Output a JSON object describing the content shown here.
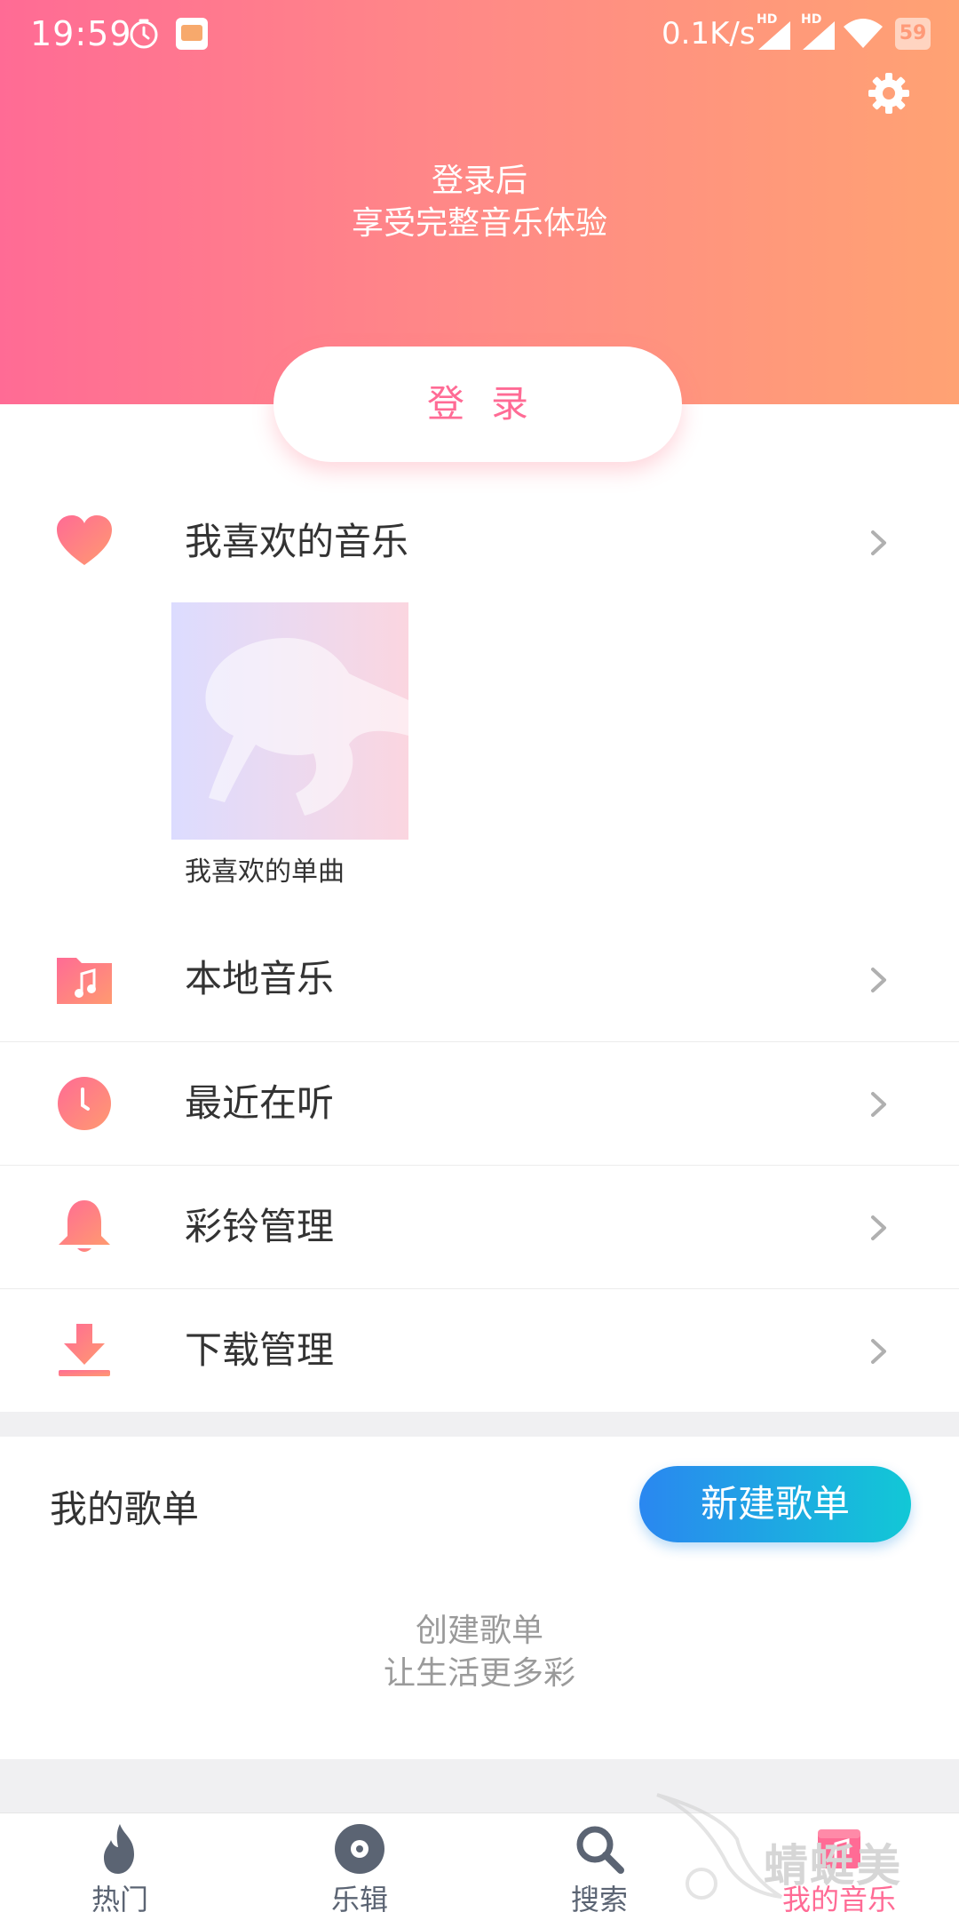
{
  "status_bar": {
    "time": "19:59",
    "network_speed": "0.1K/s",
    "hd_label": "HD",
    "battery": "59"
  },
  "header": {
    "line1": "登录后",
    "line2": "享受完整音乐体验",
    "login_label": "登录",
    "gradient_colors": [
      "#ff6b95",
      "#ffa273"
    ]
  },
  "favorites": {
    "label": "我喜欢的音乐",
    "card_caption": "我喜欢的单曲"
  },
  "menu": [
    {
      "label": "本地音乐",
      "icon": "music-folder-icon"
    },
    {
      "label": "最近在听",
      "icon": "clock-icon"
    },
    {
      "label": "彩铃管理",
      "icon": "bell-icon"
    },
    {
      "label": "下载管理",
      "icon": "download-icon"
    }
  ],
  "playlists": {
    "title": "我的歌单",
    "new_button": "新建歌单",
    "empty_line1": "创建歌单",
    "empty_line2": "让生活更多彩"
  },
  "tabs": [
    {
      "label": "热门",
      "icon": "flame-icon",
      "active": false
    },
    {
      "label": "乐辑",
      "icon": "disc-icon",
      "active": false
    },
    {
      "label": "搜索",
      "icon": "search-icon",
      "active": false
    },
    {
      "label": "我的音乐",
      "icon": "my-music-icon",
      "active": true
    }
  ],
  "accent_color": "#ff6b95",
  "watermark_text": "蜻蜓美"
}
